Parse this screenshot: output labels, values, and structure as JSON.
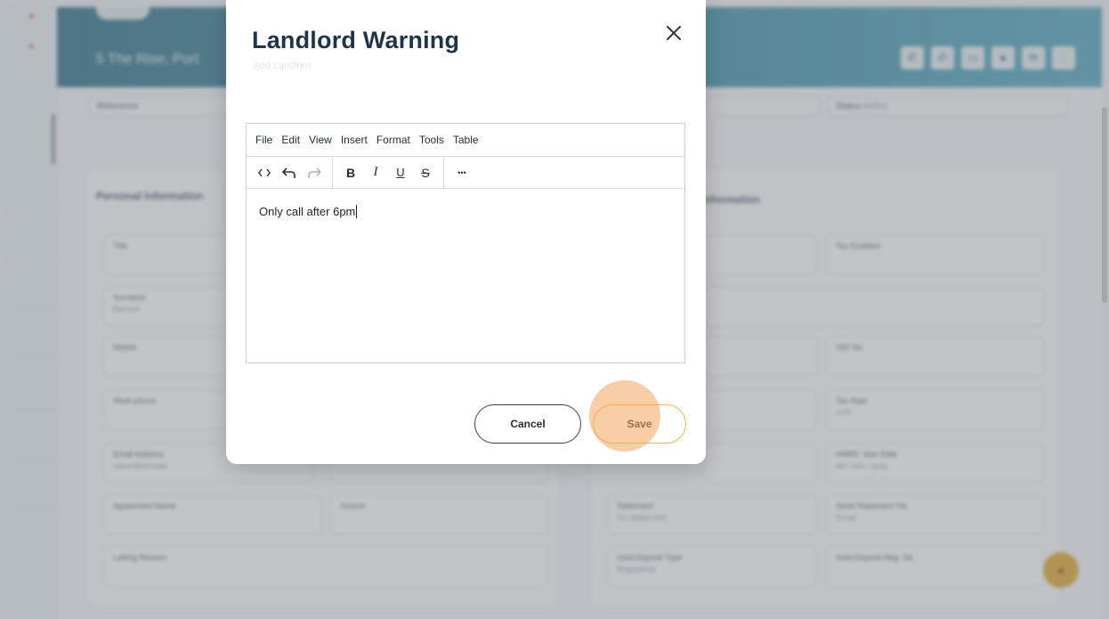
{
  "modal": {
    "title": "Landlord Warning",
    "subtitle": "Add Landlord"
  },
  "editor": {
    "menu": [
      "File",
      "Edit",
      "View",
      "Insert",
      "Format",
      "Tools",
      "Table"
    ],
    "toolbar": {
      "source_code_icon": "code-icon",
      "undo_icon": "undo-icon",
      "redo_icon": "redo-icon",
      "bold": "B",
      "italic": "I",
      "underline": "U",
      "strikethrough": "S",
      "more": "•••"
    },
    "content": "Only call after 6pm"
  },
  "buttons": {
    "cancel": "Cancel",
    "save": "Save"
  },
  "background": {
    "address": "5 The Rise, Port",
    "reference_label": "Reference",
    "status_label": "Status",
    "status_value": "Active",
    "section_personal": "Personal Information",
    "section_right": "Information",
    "fields": {
      "title": "Title",
      "surname": "Surname",
      "surname_value": "Record",
      "mobile": "Mobile",
      "work_phone": "Work phone",
      "email": "Email Address",
      "email_value": "name@domain",
      "agreement_name": "Agreement Name",
      "letting_reason": "Letting Reason",
      "vat_number": "VAT No",
      "tax_rate": "Tax Rate",
      "tax_rate_value": "0.00",
      "hmrc_date": "HMRC Year Date",
      "hmrc_date_value": "dd / mm / yyyy",
      "statement": "Statement",
      "statement_value": "On Statement",
      "send_statement": "Send Statement Via",
      "send_statement_value": "Email",
      "deposit_type": "Hold Deposit Type",
      "deposit_type_value": "Registered",
      "deposit_reg": "Hold Deposit Reg. No",
      "tax_enabled": "Tax Enabled",
      "source": "Source"
    }
  },
  "colors": {
    "header": "#3c8ea6",
    "title": "#1f3448",
    "save_border": "#e7b549",
    "click_highlight": "#f5a55a",
    "fab": "#e0a42a"
  }
}
